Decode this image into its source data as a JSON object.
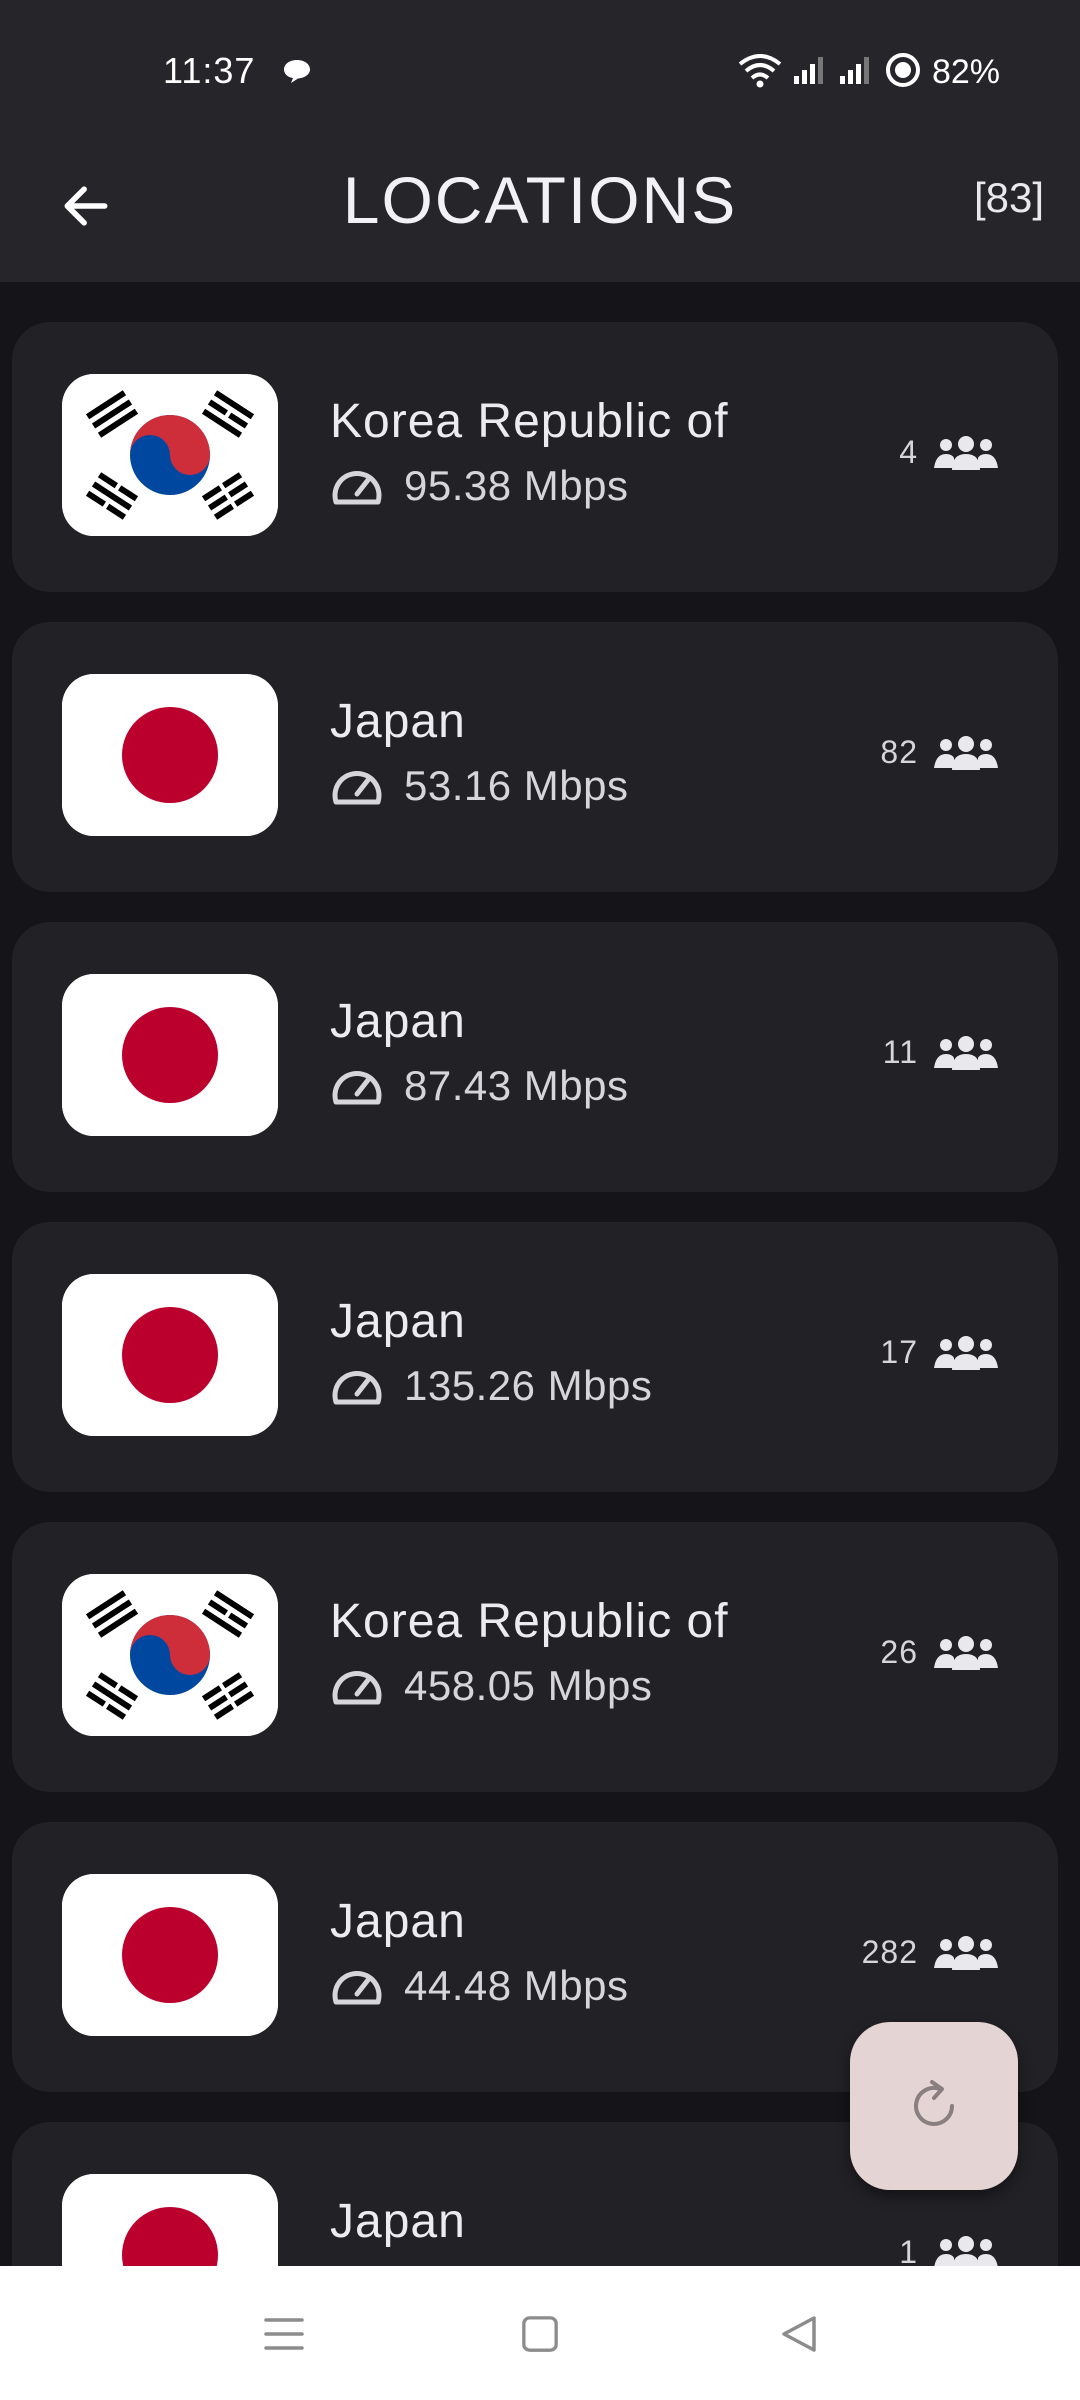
{
  "status_bar": {
    "time": "11:37",
    "battery": "82%"
  },
  "app_bar": {
    "title": "LOCATIONS",
    "count": "[83]"
  },
  "locations": [
    {
      "country": "Korea Republic of",
      "flag": "kr",
      "speed": "95.38 Mbps",
      "users": "4"
    },
    {
      "country": "Japan",
      "flag": "jp",
      "speed": "53.16 Mbps",
      "users": "82"
    },
    {
      "country": "Japan",
      "flag": "jp",
      "speed": "87.43 Mbps",
      "users": "11"
    },
    {
      "country": "Japan",
      "flag": "jp",
      "speed": "135.26 Mbps",
      "users": "17"
    },
    {
      "country": "Korea Republic of",
      "flag": "kr",
      "speed": "458.05 Mbps",
      "users": "26"
    },
    {
      "country": "Japan",
      "flag": "jp",
      "speed": "44.48 Mbps",
      "users": "282"
    },
    {
      "country": "Japan",
      "flag": "jp",
      "speed": "",
      "users": "1"
    }
  ],
  "icons": {
    "back": "arrow-left-icon",
    "speed": "speedometer-icon",
    "users": "users-group-icon",
    "refresh": "refresh-icon",
    "nav_menu": "menu-lines-icon",
    "nav_home": "square-home-icon",
    "nav_back": "triangle-back-icon"
  },
  "colors": {
    "background": "#151418",
    "card": "#222126",
    "app_bar": "#26252a",
    "fab": "#e4d4d4",
    "japan_red": "#bc002d",
    "korea_red": "#cd2e3a",
    "korea_blue": "#0047a0"
  }
}
